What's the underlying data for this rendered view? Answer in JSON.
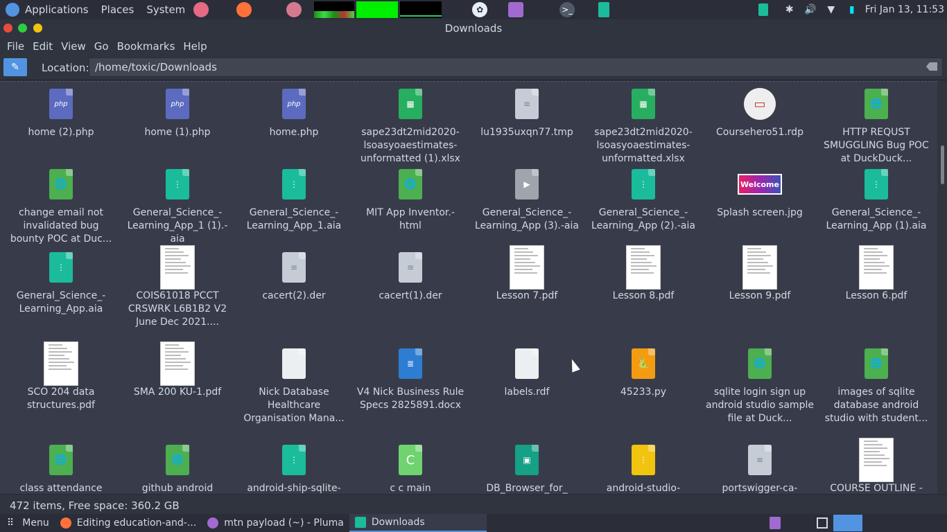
{
  "top_panel": {
    "applications": "Applications",
    "places": "Places",
    "system": "System",
    "clock": "Fri Jan 13, 11:53"
  },
  "window": {
    "title": "Downloads"
  },
  "menubar": {
    "file": "File",
    "edit": "Edit",
    "view": "View",
    "go": "Go",
    "bookmarks": "Bookmarks",
    "help": "Help"
  },
  "location": {
    "label": "Location:",
    "value": "/home/toxic/Downloads"
  },
  "files": [
    {
      "name": "home (2).php",
      "type": "php"
    },
    {
      "name": "home (1).php",
      "type": "php"
    },
    {
      "name": "home.php",
      "type": "php"
    },
    {
      "name": "sape23dt2mid2020-lsoasyoaestimates-unformatted (1).xlsx",
      "type": "sheet"
    },
    {
      "name": "lu1935uxqn77.tmp",
      "type": "text"
    },
    {
      "name": "sape23dt2mid2020-lsoasyoaestimates-unformatted.xlsx",
      "type": "sheet"
    },
    {
      "name": "Coursehero51.rdp",
      "type": "rdp"
    },
    {
      "name": "HTTP REQUST SMUGGLING Bug POC at DuckDuck...",
      "type": "html"
    },
    {
      "name": "change email not invalidated bug bounty POC at Duc...",
      "type": "html"
    },
    {
      "name": "General_Science_-Learning_App_1 (1).-aia",
      "type": "archive"
    },
    {
      "name": "General_Science_-Learning_App_1.aia",
      "type": "archive"
    },
    {
      "name": "MIT App Inventor.-html",
      "type": "html"
    },
    {
      "name": "General_Science_-Learning_App (3).-aia",
      "type": "media"
    },
    {
      "name": "General_Science_-Learning_App (2).-aia",
      "type": "archive"
    },
    {
      "name": "Splash screen.jpg",
      "type": "image"
    },
    {
      "name": "General_Science_-Learning_App (1).aia",
      "type": "archive"
    },
    {
      "name": "General_Science_-Learning_App.aia",
      "type": "archive"
    },
    {
      "name": "COIS61018 PCCT CRSWRK L6B1B2 V2 June Dec 2021....",
      "type": "pdf"
    },
    {
      "name": "cacert(2).der",
      "type": "text"
    },
    {
      "name": "cacert(1).der",
      "type": "text"
    },
    {
      "name": "Lesson 7.pdf",
      "type": "pdf"
    },
    {
      "name": "Lesson 8.pdf",
      "type": "pdf"
    },
    {
      "name": "Lesson 9.pdf",
      "type": "pdf"
    },
    {
      "name": "Lesson 6.pdf",
      "type": "pdf"
    },
    {
      "name": "SCO 204 data structures.pdf",
      "type": "pdf"
    },
    {
      "name": "SMA 200 KU-1.pdf",
      "type": "pdf"
    },
    {
      "name": "Nick Database Healthcare Organisation Mana...",
      "type": "blank"
    },
    {
      "name": "V4 Nick Business Rule Specs 2825891.docx",
      "type": "doc"
    },
    {
      "name": "labels.rdf",
      "type": "blank"
    },
    {
      "name": "45233.py",
      "type": "python"
    },
    {
      "name": "sqlite login sign up android studio sample file at Duck...",
      "type": "html"
    },
    {
      "name": "images of sqlite database android studio with student...",
      "type": "html"
    },
    {
      "name": "class attendance",
      "type": "html"
    },
    {
      "name": "github android",
      "type": "html"
    },
    {
      "name": "android-ship-sqlite-",
      "type": "archive"
    },
    {
      "name": "c c main",
      "type": "csrc"
    },
    {
      "name": "DB_Browser_for_",
      "type": "appimg"
    },
    {
      "name": "android-studio-",
      "type": "yellowarch"
    },
    {
      "name": "portswigger-ca-",
      "type": "text"
    },
    {
      "name": "COURSE OUTLINE -",
      "type": "pdf"
    }
  ],
  "status": {
    "text": "472 items, Free space: 360.2 GB"
  },
  "taskbar": {
    "menu": "Menu",
    "task1": "Editing education-and-...",
    "task2": "mtn payload (~) - Pluma",
    "task3": "Downloads"
  },
  "colors": {
    "accent": "#5294e2",
    "sheet": "#27ae60",
    "html": "#4caf50",
    "archive": "#1abc9c",
    "php": "#5c6bc0",
    "python": "#f39c12",
    "doc": "#2d7dd2"
  }
}
